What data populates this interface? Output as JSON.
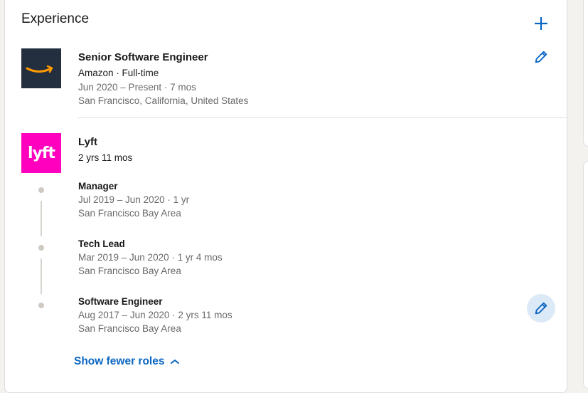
{
  "section": {
    "title": "Experience",
    "add_icon": "plus-icon",
    "edit_icon": "pencil-icon"
  },
  "amazon": {
    "title": "Senior Software Engineer",
    "company_line": "Amazon · Full-time",
    "dates": "Jun 2020 – Present",
    "duration": "7 mos",
    "location": "San Francisco, California, United States"
  },
  "lyft": {
    "logo_text": "lyft",
    "company": "Lyft",
    "total_duration": "2 yrs 11 mos",
    "roles": [
      {
        "title": "Manager",
        "dates": "Jul 2019 – Jun 2020",
        "duration": "1 yr",
        "location": "San Francisco Bay Area"
      },
      {
        "title": "Tech Lead",
        "dates": "Mar 2019 – Jun 2020",
        "duration": "1 yr 4 mos",
        "location": "San Francisco Bay Area"
      },
      {
        "title": "Software Engineer",
        "dates": "Aug 2017 – Jun 2020",
        "duration": "2 yrs 11 mos",
        "location": "San Francisco Bay Area"
      }
    ],
    "show_fewer_label": "Show fewer roles"
  },
  "colors": {
    "accent": "#0a66c2",
    "lyft_pink": "#ff00bf",
    "amazon_bg": "#232f3e",
    "amazon_smile": "#ff9900"
  }
}
